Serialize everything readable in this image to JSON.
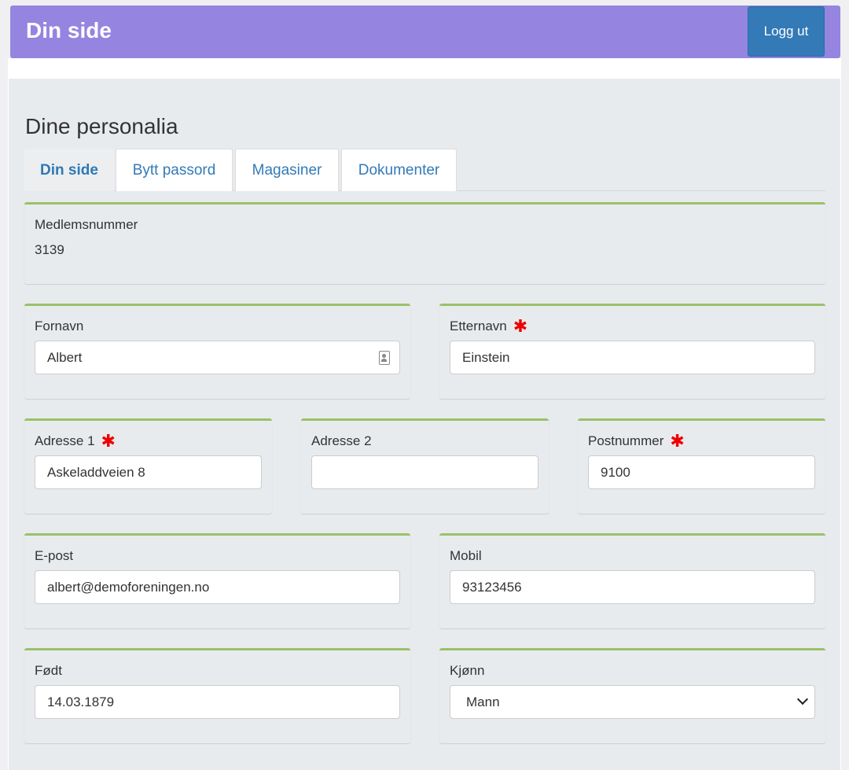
{
  "header": {
    "title": "Din side",
    "logout_label": "Logg ut"
  },
  "page_title": "Dine personalia",
  "tabs": [
    {
      "label": "Din side",
      "active": true
    },
    {
      "label": "Bytt passord",
      "active": false
    },
    {
      "label": "Magasiner",
      "active": false
    },
    {
      "label": "Dokumenter",
      "active": false
    }
  ],
  "form": {
    "medlemsnummer": {
      "label": "Medlemsnummer",
      "value": "3139"
    },
    "fornavn": {
      "label": "Fornavn",
      "value": "Albert"
    },
    "etternavn": {
      "label": "Etternavn",
      "value": "Einstein"
    },
    "adresse1": {
      "label": "Adresse 1",
      "value": "Askeladdveien 8"
    },
    "adresse2": {
      "label": "Adresse 2",
      "value": ""
    },
    "postnummer": {
      "label": "Postnummer",
      "value": "9100"
    },
    "epost": {
      "label": "E-post",
      "value": "albert@demoforeningen.no"
    },
    "mobil": {
      "label": "Mobil",
      "value": "93123456"
    },
    "fodt": {
      "label": "Født",
      "value": "14.03.1879"
    },
    "kjonn": {
      "label": "Kjønn",
      "value": "Mann"
    }
  },
  "required_marker": "✱",
  "colors": {
    "header": "#9585e0",
    "accent": "#9ac168",
    "button": "#337ab7",
    "required": "#ee0000"
  }
}
